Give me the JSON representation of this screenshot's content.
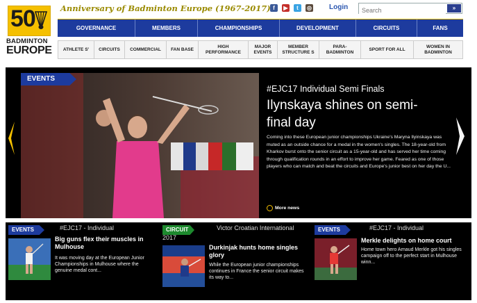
{
  "brand": {
    "logo_number": "50",
    "logo_line1": "BADMINTON",
    "logo_line2": "EUROPE",
    "anniversary": "Anniversary of Badminton Europe (1967-2017)"
  },
  "header": {
    "social_icons": [
      "facebook-icon",
      "youtube-icon",
      "twitter-icon",
      "instagram-icon"
    ],
    "login_label": "Login",
    "search_placeholder": "Search"
  },
  "main_nav": [
    "GOVERNANCE",
    "MEMBERS",
    "CHAMPIONSHIPS",
    "DEVELOPMENT",
    "CIRCUITS",
    "FANS"
  ],
  "sub_nav": [
    "ATHLETE S'",
    "CIRCUITS",
    "COMMERCIAL",
    "FAN BASE",
    "HIGH PERFORMANCE",
    "MAJOR EVENTS",
    "MEMBER STRUCTURE S",
    "PARA-BADMINTON",
    "SPORT FOR ALL",
    "WOMEN IN BADMINTON"
  ],
  "hero": {
    "tag": "EVENTS",
    "category": "#EJC17 Individual Semi Finals",
    "title": "Ilynskaya shines on semi-final day",
    "summary": "Coming into these European junior championships Ukraine's Maryna Ilyinskaya was muted as an outside chance for a medal in the women's singles. The 18-year-old from Kharkov burst onto the senior circuit as a 15-year-old and has served her time coming through qualification rounds in an effort to improve her game.  Feared as one of those players who can match and beat the circuits and Europe's junior best on her day the U...",
    "more_label": "More news"
  },
  "cards": [
    {
      "tag": "EVENTS",
      "tag_color": "#1d3b9e",
      "category": "#EJC17 - Individual",
      "title": "Big guns flex their muscles in Mulhouse",
      "summary": "It was moving day at the European Junior Championships in Mulhouse where the genuine medal cont..."
    },
    {
      "tag": "CIRCUIT",
      "tag_color": "#1d8a2e",
      "category_line1": "Victor Croatian International",
      "category_line2": "2017",
      "title": "Durkinjak hunts home singles glory",
      "summary": "While the European junior championships continues in France the senior circuit makes its way to..."
    },
    {
      "tag": "EVENTS",
      "tag_color": "#1d3b9e",
      "category": "#EJC17 - Individual",
      "title": "Merkle delights on home court",
      "summary": "Home town hero Arnaud Merkle got his singles campaign off to the perfect start in Mulhouse winn..."
    }
  ],
  "colors": {
    "brand_blue": "#1d3b9e",
    "brand_yellow": "#f5c000",
    "circuit_green": "#1d8a2e",
    "slider_bg": "#000000"
  }
}
